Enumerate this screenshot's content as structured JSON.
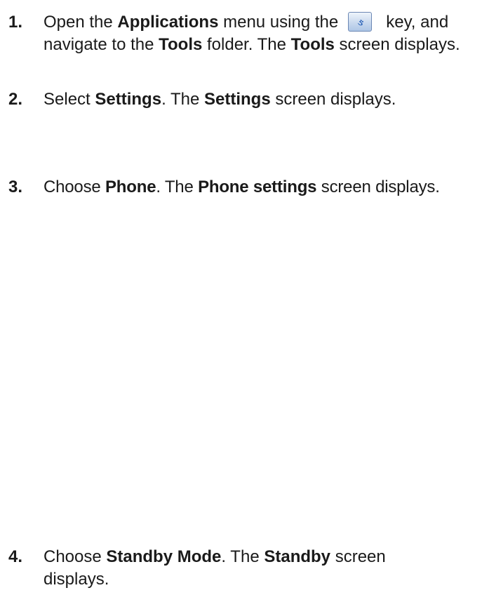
{
  "steps": [
    {
      "number": "1.",
      "parts": {
        "a": "Open the ",
        "b_applications": "Applications",
        "c": " menu using the",
        "d": "key, and navigate to the ",
        "e_tools": "Tools",
        "f": " folder. The ",
        "g_tools": "Tools",
        "h": " screen displays."
      },
      "icon": "applications-key-icon"
    },
    {
      "number": "2.",
      "parts": {
        "a": "Select ",
        "b_settings": "Settings",
        "c": ". The ",
        "d_settings": "Settings",
        "e": " screen displays."
      }
    },
    {
      "number": "3.",
      "parts": {
        "a": "Choose ",
        "b_phone": "Phone",
        "c": ". The ",
        "d_phone_settings": "Phone settings",
        "e": " screen displays."
      }
    },
    {
      "number": "4.",
      "parts": {
        "a": "Choose ",
        "b_standby_mode": "Standby Mode",
        "c": ". The ",
        "d_standby": "Standby",
        "e": " screen displays."
      }
    }
  ],
  "colors": {
    "text": "#1a1a1a",
    "icon_border": "#6b87b4",
    "icon_glyph": "#2a62b8"
  }
}
